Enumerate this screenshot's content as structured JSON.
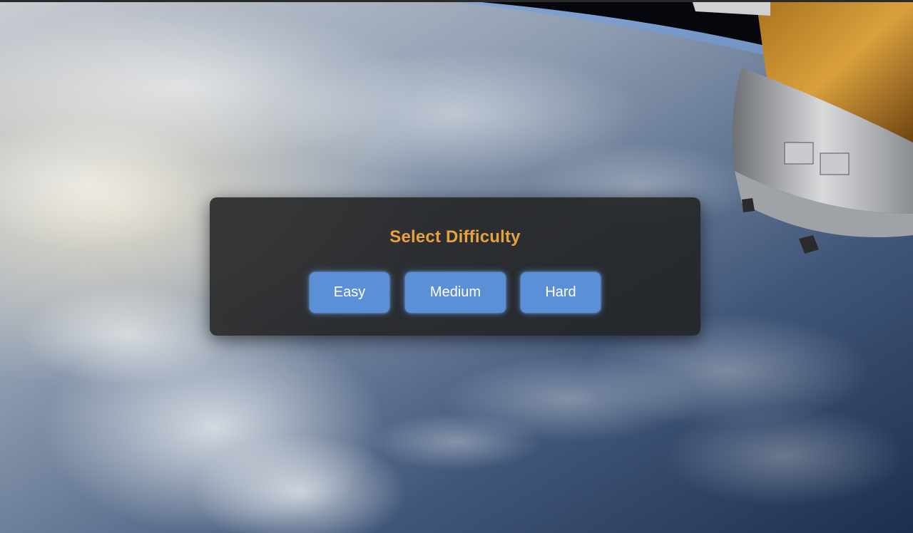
{
  "dialog": {
    "title": "Select Difficulty",
    "buttons": {
      "easy": "Easy",
      "medium": "Medium",
      "hard": "Hard"
    }
  },
  "colors": {
    "title": "#e9a23b",
    "button": "#5b8fd6",
    "panel": "#202020"
  }
}
